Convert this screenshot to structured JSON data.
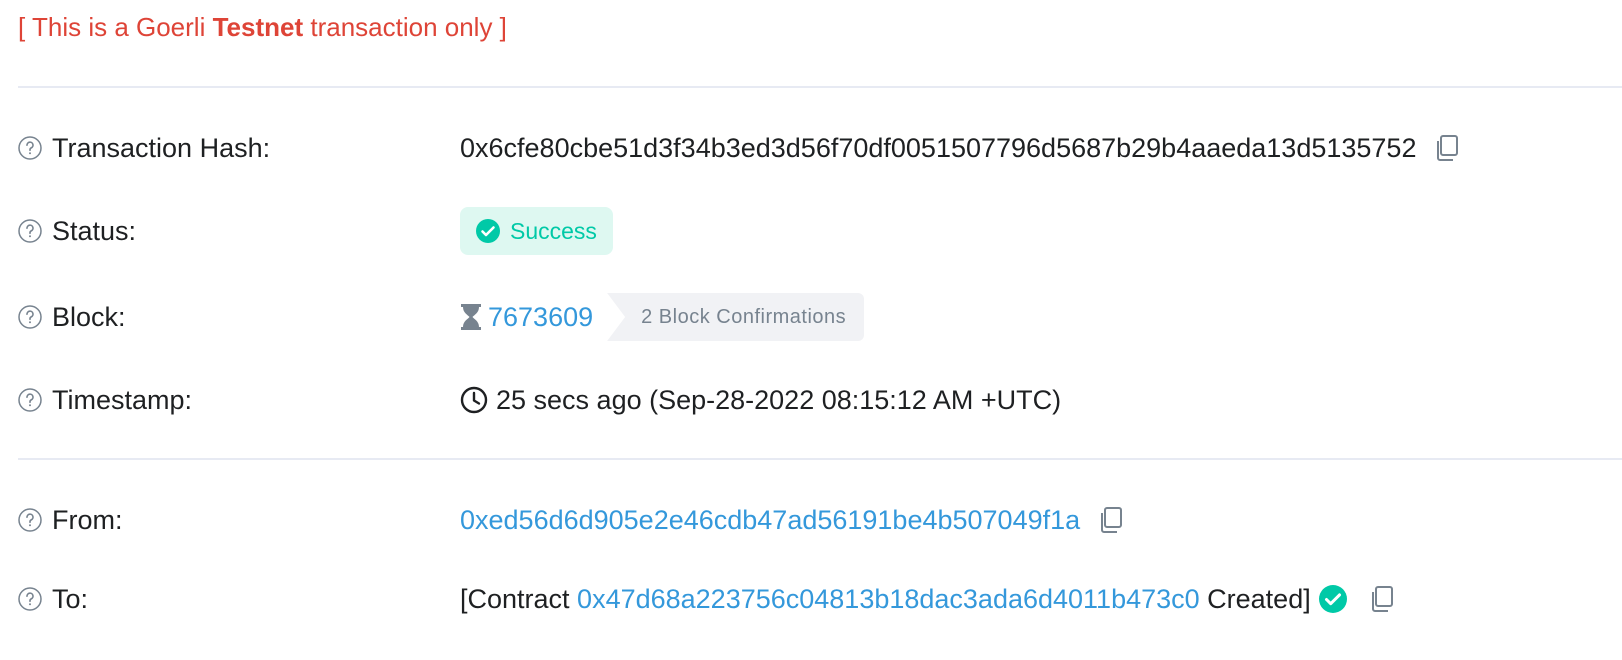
{
  "banner": {
    "prefix": "[ This is a Goerli ",
    "emphasis": "Testnet",
    "suffix": " transaction only ]"
  },
  "rows": {
    "tx_hash": {
      "label": "Transaction Hash:",
      "value": "0x6cfe80cbe51d3f34b3ed3d56f70df0051507796d5687b29b4aaeda13d5135752"
    },
    "status": {
      "label": "Status:",
      "value": "Success"
    },
    "block": {
      "label": "Block:",
      "number": "7673609",
      "confirmations": "2 Block Confirmations"
    },
    "timestamp": {
      "label": "Timestamp:",
      "value": "25 secs ago (Sep-28-2022 08:15:12 AM +UTC)"
    },
    "from": {
      "label": "From:",
      "address": "0xed56d6d905e2e46cdb47ad56191be4b507049f1a"
    },
    "to": {
      "label": "To:",
      "prefix": "[Contract ",
      "address": "0x47d68a223756c04813b18dac3ada6d4011b473c0",
      "suffix": " Created]"
    }
  },
  "icons": {
    "help": "question-circle-icon",
    "copy": "copy-icon",
    "success": "check-circle-icon",
    "pending": "hourglass-icon",
    "time": "clock-icon"
  },
  "colors": {
    "banner": "#de4437",
    "link": "#3498db",
    "success": "#00c9a7",
    "success_bg": "#def8f1",
    "muted": "#77838f"
  }
}
